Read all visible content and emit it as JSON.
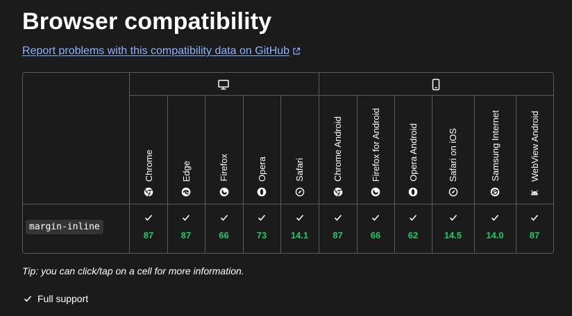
{
  "heading": "Browser compatibility",
  "report_link": "Report problems with this compatibility data on GitHub",
  "platforms": [
    {
      "name": "desktop",
      "icon": "desktop-icon"
    },
    {
      "name": "mobile",
      "icon": "mobile-icon"
    }
  ],
  "browsers": [
    {
      "name": "Chrome",
      "icon": "chrome-icon",
      "version": "87"
    },
    {
      "name": "Edge",
      "icon": "edge-icon",
      "version": "87"
    },
    {
      "name": "Firefox",
      "icon": "firefox-icon",
      "version": "66"
    },
    {
      "name": "Opera",
      "icon": "opera-icon",
      "version": "73"
    },
    {
      "name": "Safari",
      "icon": "safari-icon",
      "version": "14.1"
    },
    {
      "name": "Chrome Android",
      "icon": "chrome-icon",
      "version": "87"
    },
    {
      "name": "Firefox for Android",
      "icon": "firefox-icon",
      "version": "66"
    },
    {
      "name": "Opera Android",
      "icon": "opera-icon",
      "version": "62"
    },
    {
      "name": "Safari on iOS",
      "icon": "safari-icon",
      "version": "14.5"
    },
    {
      "name": "Samsung Internet",
      "icon": "samsung-internet-icon",
      "version": "14.0"
    },
    {
      "name": "WebView Android",
      "icon": "android-icon",
      "version": "87"
    }
  ],
  "feature": "margin-inline",
  "tip": "Tip: you can click/tap on a cell for more information.",
  "legend": {
    "label": "Full support",
    "icon": "checkmark-icon"
  },
  "colors": {
    "background": "#1b1b1b",
    "link": "#8cb4ff",
    "supported": "#1ec864",
    "border": "#5b5b5b"
  }
}
